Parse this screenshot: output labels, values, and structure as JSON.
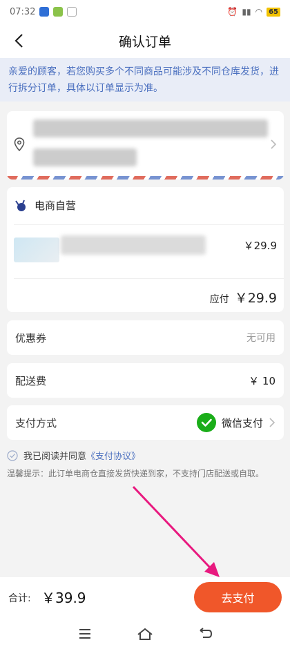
{
  "statusbar": {
    "time": "07:32",
    "battery": "65"
  },
  "header": {
    "title": "确认订单"
  },
  "notice": {
    "text": "亲爱的顾客，若您购买多个不同商品可能涉及不同仓库发货，进行拆分订单，具体以订单显示为准。"
  },
  "shop": {
    "name": "电商自营",
    "product_price": "￥29.9",
    "payable_label": "应付",
    "payable_value": "￥29.9"
  },
  "coupon": {
    "label": "优惠券",
    "value": "无可用"
  },
  "shipping": {
    "label": "配送费",
    "value": "￥ 10"
  },
  "payment": {
    "label": "支付方式",
    "method": "微信支付"
  },
  "agreement": {
    "prefix": "我已阅读并同意",
    "link": "《支付协议》"
  },
  "tip": "温馨提示：此订单电商仓直接发货快递到家，不支持门店配送或自取。",
  "footer": {
    "total_label": "合计:",
    "total_value": "￥39.9",
    "pay_button": "去支付"
  },
  "colors": {
    "accent": "#f0572a",
    "link": "#4a6fbf",
    "wechat": "#1aad19",
    "annotation_arrow": "#e8197f"
  }
}
